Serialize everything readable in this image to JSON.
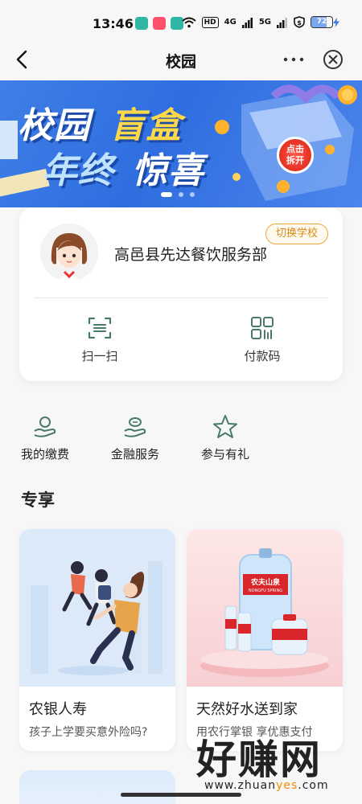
{
  "status_bar": {
    "time": "13:46",
    "hd_label": "HD",
    "network_1": "4G",
    "network_2": "5G",
    "battery_percent": "72",
    "battery_level": 0.72,
    "app_icon_colors": [
      "#2fb7a4",
      "#ff4f6a",
      "#2fb7a4"
    ]
  },
  "nav": {
    "title": "校园",
    "back_icon": "chevron-left-icon",
    "more_icon": "more-horizontal-icon",
    "close_icon": "close-circle-icon"
  },
  "banner": {
    "line1_part1": "校园",
    "line1_part2": "盲盒",
    "line2_part1": "年终",
    "line2_part2": "惊喜",
    "cta_line1": "点击",
    "cta_line2": "拆开",
    "pages": 3,
    "active_page": 1
  },
  "school_card": {
    "name": "高邑县先达餐饮服务部",
    "switch_label": "切换学校",
    "actions": [
      {
        "label": "扫一扫",
        "icon": "scan-icon"
      },
      {
        "label": "付款码",
        "icon": "qr-code-icon"
      }
    ]
  },
  "services": [
    {
      "label": "我的缴费",
      "icon": "payment-hand-icon"
    },
    {
      "label": "金融服务",
      "icon": "finance-hand-icon"
    },
    {
      "label": "参与有礼",
      "icon": "star-icon"
    }
  ],
  "section": {
    "title": "专享"
  },
  "promos": [
    {
      "title": "农银人寿",
      "subtitle": "孩子上学要买意外险吗?",
      "image": "students-illustration"
    },
    {
      "title": "天然好水送到家",
      "subtitle": "用农行掌银 享优惠支付",
      "image": "water-bottles"
    }
  ],
  "water_brand": {
    "cn": "农夫山泉",
    "en": "NONGFU SPRING"
  },
  "watermark": {
    "big": "好赚网",
    "small_pre": "www.zhuan",
    "small_hl": "yes",
    "small_post": ".com"
  },
  "colors": {
    "accent_orange": "#e9a93a",
    "banner_blue": "#3f7fe6",
    "icon_green": "#4a7a6d"
  }
}
